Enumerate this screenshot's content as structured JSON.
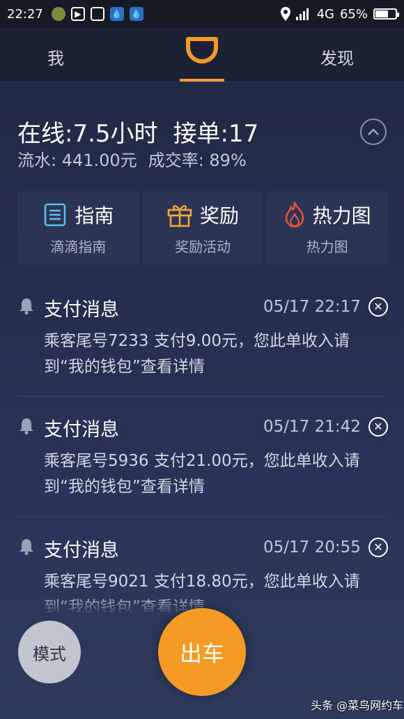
{
  "status_bar": {
    "time": "22:27",
    "network": "4G",
    "battery": "65%",
    "battery_level": 0.65
  },
  "tabs": {
    "me": "我",
    "discover": "发现"
  },
  "stats": {
    "online": "在线:7.5小时",
    "orders": "接单:17",
    "revenue": "流水: 441.00元",
    "rate": "成交率: 89%"
  },
  "cards": [
    {
      "title": "指南",
      "subtitle": "滴滴指南",
      "icon": "guide-icon",
      "color": "#5bc0f0"
    },
    {
      "title": "奖励",
      "subtitle": "奖励活动",
      "icon": "gift-icon",
      "color": "#f5a53a"
    },
    {
      "title": "热力图",
      "subtitle": "热力图",
      "icon": "flame-icon",
      "color": "#e5533d"
    }
  ],
  "messages": [
    {
      "title": "支付消息",
      "time": "05/17 22:17",
      "body": "乘客尾号7233 支付9.00元，您此单收入请到“我的钱包”查看详情"
    },
    {
      "title": "支付消息",
      "time": "05/17 21:42",
      "body": "乘客尾号5936 支付21.00元，您此单收入请到“我的钱包”查看详情"
    },
    {
      "title": "支付消息",
      "time": "05/17 20:55",
      "body": "乘客尾号9021 支付18.80元，您此单收入请到“我的钱包”查看详情"
    }
  ],
  "buttons": {
    "mode": "模式",
    "go": "出车"
  },
  "watermark": "头条 @菜鸟网约车",
  "colors": {
    "accent": "#f59a24",
    "background": "#252d4d"
  }
}
